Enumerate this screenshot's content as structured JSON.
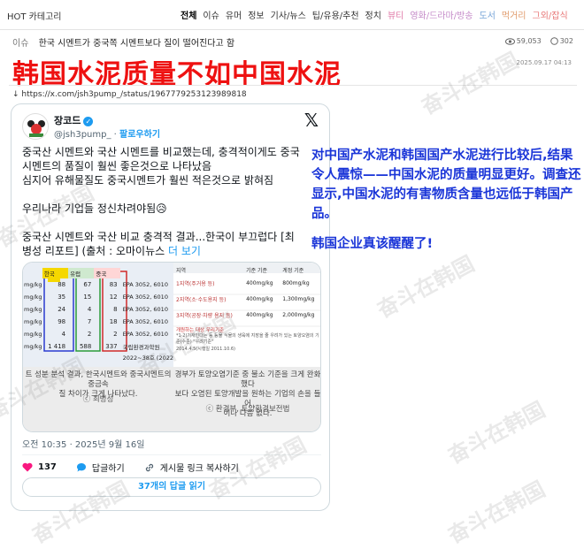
{
  "header": {
    "site_name": "HOT 카테고리",
    "nav_items": [
      {
        "label": "전체",
        "color": "#000000",
        "active": true
      },
      {
        "label": "이슈",
        "color": "#333333"
      },
      {
        "label": "유머",
        "color": "#333333"
      },
      {
        "label": "정보",
        "color": "#333333"
      },
      {
        "label": "기사/뉴스",
        "color": "#333333"
      },
      {
        "label": "팁/유용/추천",
        "color": "#333333"
      },
      {
        "label": "정치",
        "color": "#333333"
      },
      {
        "label": "뷰티",
        "color": "#e07aa8"
      },
      {
        "label": "영화/드라마/방송",
        "color": "#c48ac8"
      },
      {
        "label": "도서",
        "color": "#7aa7d8"
      },
      {
        "label": "먹거리",
        "color": "#e09a6a"
      },
      {
        "label": "그외/잡식",
        "color": "#e87878"
      }
    ]
  },
  "breadcrumb": {
    "category": "이슈",
    "title": "한국 시멘트가 중국쪽 시멘트보다 질이 떨어진다고 함"
  },
  "stats": {
    "views": "59,053",
    "comments": "302"
  },
  "headline": "韩国水泥质量不如中国水泥",
  "headline_color": "#ee1111",
  "date": "2025.09.17 04:13",
  "source_url": "https://x.com/jsh3pump_/status/1967779253123989818",
  "tweet": {
    "display_name": "장코드",
    "handle": "@jsh3pump_",
    "follow_label": "팔로우하기",
    "lines": [
      "중국산 시멘트와 국산 시멘트를 비교했는데, 충격적이게도 중국",
      "시멘트의 품질이 훨씬 좋은것으로 나타났음",
      "심지어 유해물질도 중국시멘트가 훨씬 적은것으로 밝혀짐",
      "",
      "우리나라 기업들 정신차려야됨😥",
      "",
      "중국산 시멘트와 국산 비교 충격적 결과...한국이 부끄럽다  [최",
      "병성 리포트] (출처 : 오마이뉴스 "
    ],
    "more_label": "더 보기",
    "time": "오전 10:35 · 2025년 9월 16일",
    "likes": "137",
    "reply_label": "답글하기",
    "copy_label": "게시물 링크 복사하기",
    "replies_button": "37개의 답글 읽기",
    "media": {
      "left_table": {
        "unit_rows": [
          "mg/kg",
          "mg/kg",
          "mg/kg",
          "mg/kg",
          "mg/kg",
          "mg/kg"
        ],
        "col_labels": [
          "한국",
          "유럽",
          "중국"
        ],
        "korea": [
          "88",
          "35",
          "24",
          "98",
          "4",
          "1 418"
        ],
        "europe": [
          "67",
          "15",
          "4",
          "7",
          "2",
          "588"
        ],
        "china": [
          "83",
          "12",
          "8",
          "18",
          "2",
          "337"
        ],
        "epa": [
          "EPA 3052, 6010",
          "EPA 3052, 6010",
          "EPA 3052, 6010",
          "EPA 3052, 6010",
          "EPA 3052, 6010",
          "국립환경과학원"
        ],
        "epa_extra": "2022~38호 (2022",
        "footnote": "트 성분 분석 결과, 한국시멘트와 중국시멘트의 중금속\n질 차이가 크게 나타났다.",
        "credit": "ⓒ 최병성"
      },
      "right_table": {
        "headers": [
          "지역",
          "기준 기준",
          "계정 기준"
        ],
        "rows": [
          [
            "1지역(주거용 등)",
            "400mg/kg",
            "800mg/kg"
          ],
          [
            "2지역(소·수도용지 등)",
            "400mg/kg",
            "1,300mg/kg"
          ],
          [
            "3지역(공장·차량 용지 등)",
            "400mg/kg",
            "2,000mg/kg"
          ]
        ],
        "note": "개원하는 대상 우리기준",
        "note2": "*1·2(기재인다는 등 등물 식물의 생육에 지장을 줄 우려가 있는 토양오염의 기준(수준) \"우려기준\"",
        "note3": "2014.4.5(시행일 2011.10.6)",
        "footnote": "경부가 토양오염기준 중 불소 기준을 크게 완화했다\n보다 오염된 토양개발을 원하는 기업의 손을 들어\n이나 다름 없다.",
        "credit": "ⓒ 환경부, 토양환경보전법"
      }
    }
  },
  "cn_commentary": {
    "paragraph1": "对中国产水泥和韩国国产水泥进行比较后,结果令人震惊——中国水泥的质量明显更好。调查还显示,中国水泥的有害物质含量也远低于韩国产品。",
    "paragraph2": "韩国企业真该醒醒了!"
  },
  "watermark": "奋斗在韩国",
  "colors": {
    "accent_blue": "#1d9bf0",
    "commentary_blue": "#1a35d8",
    "like_red": "#f91880"
  }
}
